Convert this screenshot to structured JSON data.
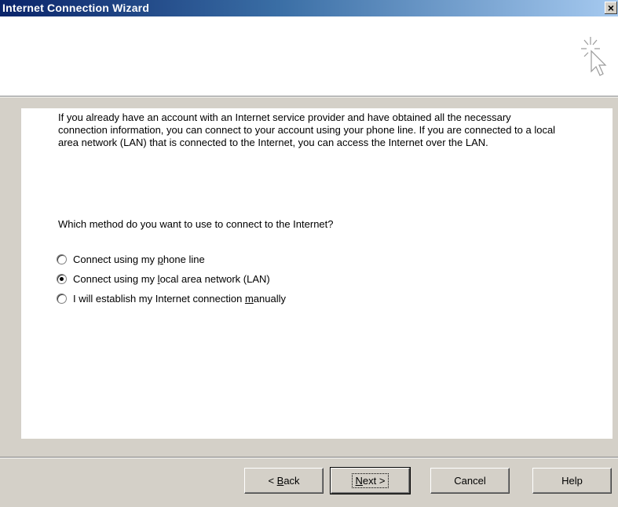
{
  "window": {
    "title": "Internet Connection Wizard",
    "close_label": "×"
  },
  "page": {
    "intro": "If you already have an account with an Internet service provider and have obtained all the necessary connection information, you can connect to your account using your phone line. If you are connected to a local area network (LAN) that is connected to the Internet, you can access the Internet over the LAN.",
    "question": "Which method do you want to use to connect to the Internet?",
    "options": [
      {
        "before": "Connect using my ",
        "mnemonic": "p",
        "after": "hone line",
        "checked": false
      },
      {
        "before": "Connect using my ",
        "mnemonic": "l",
        "after": "ocal area network (LAN)",
        "checked": true
      },
      {
        "before": "I will establish my Internet connection ",
        "mnemonic": "m",
        "after": "anually",
        "checked": false
      }
    ]
  },
  "buttons": {
    "back": {
      "before": "< ",
      "mnemonic": "B",
      "after": "ack"
    },
    "next": {
      "before": "",
      "mnemonic": "N",
      "after": "ext >"
    },
    "cancel": "Cancel",
    "help": "Help"
  }
}
